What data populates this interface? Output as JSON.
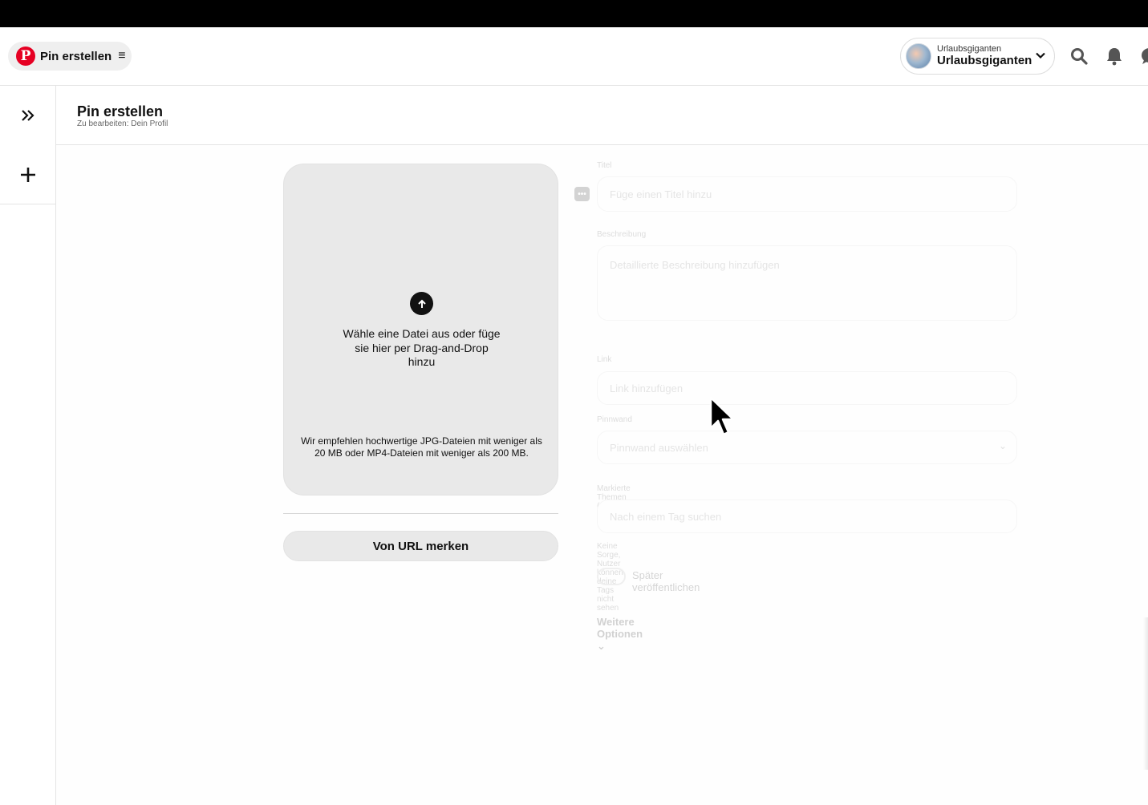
{
  "header": {
    "brand_label": "Pin erstellen",
    "account": {
      "small_name": "Urlaubsgiganten",
      "big_name": "Urlaubsgiganten"
    }
  },
  "page": {
    "title": "Pin erstellen",
    "subtitle": "Zu bearbeiten: Dein Profil"
  },
  "upload": {
    "main_text": "Wähle eine Datei aus oder füge sie hier per Drag-and-Drop hinzu",
    "hint_text": "Wir empfehlen hochwertige JPG-Dateien mit weniger als 20 MB oder MP4-Dateien mit weniger als 200 MB.",
    "url_button": "Von URL merken"
  },
  "form": {
    "title_label": "Titel",
    "title_placeholder": "Füge einen Titel hinzu",
    "description_label": "Beschreibung",
    "description_placeholder": "Detaillierte Beschreibung hinzufügen",
    "link_label": "Link",
    "link_placeholder": "Link hinzufügen",
    "board_label": "Pinnwand",
    "board_placeholder": "Pinnwand auswählen",
    "topics_label": "Markierte Themen (0)",
    "topics_placeholder": "Nach einem Tag suchen",
    "topics_hint": "Keine Sorge, Nutzer können deine Tags nicht sehen",
    "schedule_label": "Später veröffentlichen",
    "more_options": "Weitere Optionen"
  }
}
